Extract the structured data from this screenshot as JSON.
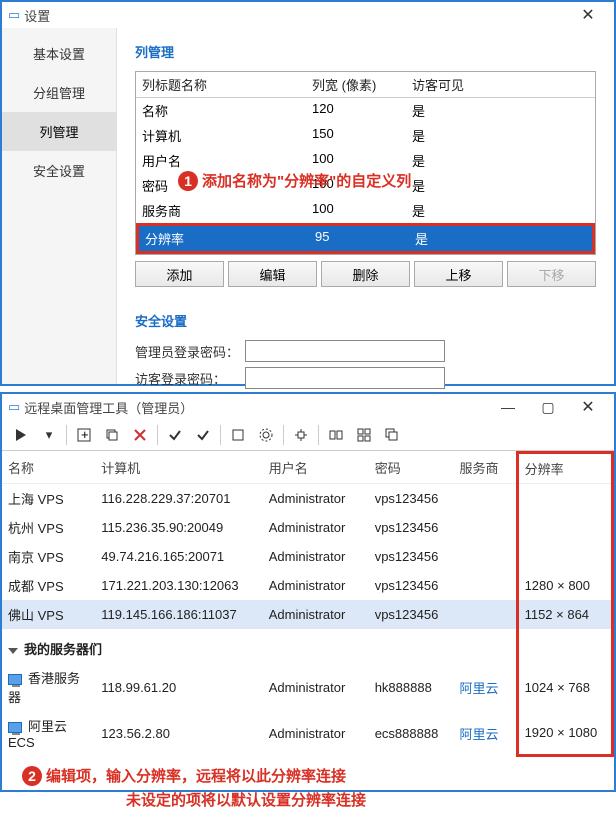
{
  "settings": {
    "title": "设置",
    "tabs": [
      "基本设置",
      "分组管理",
      "列管理",
      "安全设置"
    ],
    "active_tab": 2,
    "panel_title": "列管理",
    "columns_header": {
      "name": "列标题名称",
      "width": "列宽 (像素)",
      "visible": "访客可见"
    },
    "columns": [
      {
        "name": "名称",
        "width": "120",
        "visible": "是"
      },
      {
        "name": "计算机",
        "width": "150",
        "visible": "是"
      },
      {
        "name": "用户名",
        "width": "100",
        "visible": "是"
      },
      {
        "name": "密码",
        "width": "100",
        "visible": "是"
      },
      {
        "name": "服务商",
        "width": "100",
        "visible": "是"
      },
      {
        "name": "分辨率",
        "width": "95",
        "visible": "是"
      }
    ],
    "selected_column": 5,
    "buttons": {
      "add": "添加",
      "edit": "编辑",
      "delete": "删除",
      "up": "上移",
      "down": "下移"
    },
    "security_title": "安全设置",
    "admin_pw_label": "管理员登录密码：",
    "guest_pw_label": "访客登录密码：",
    "annot": "添加名称为\"分辨率\"的自定义列"
  },
  "main": {
    "title": "远程桌面管理工具（管理员）",
    "headers": [
      "名称",
      "计算机",
      "用户名",
      "密码",
      "服务商",
      "分辨率"
    ],
    "rows": [
      {
        "name": "上海 VPS",
        "host": "116.228.229.37:20701",
        "user": "Administrator",
        "pass": "vps123456",
        "prov": "",
        "res": ""
      },
      {
        "name": "杭州 VPS",
        "host": "115.236.35.90:20049",
        "user": "Administrator",
        "pass": "vps123456",
        "prov": "",
        "res": ""
      },
      {
        "name": "南京 VPS",
        "host": "49.74.216.165:20071",
        "user": "Administrator",
        "pass": "vps123456",
        "prov": "",
        "res": ""
      },
      {
        "name": "成都 VPS",
        "host": "171.221.203.130:12063",
        "user": "Administrator",
        "pass": "vps123456",
        "prov": "",
        "res": "1280 × 800"
      },
      {
        "name": "佛山 VPS",
        "host": "119.145.166.186:11037",
        "user": "Administrator",
        "pass": "vps123456",
        "prov": "",
        "res": "1152 × 864"
      }
    ],
    "selected_row": 4,
    "group_name": "我的服务器们",
    "group_rows": [
      {
        "name": "香港服务器",
        "host": "118.99.61.20",
        "user": "Administrator",
        "pass": "hk888888",
        "prov": "阿里云",
        "res": "1024 × 768"
      },
      {
        "name": "阿里云 ECS",
        "host": "123.56.2.80",
        "user": "Administrator",
        "pass": "ecs888888",
        "prov": "阿里云",
        "res": "1920 × 1080"
      }
    ],
    "annot_line1": "编辑项，输入分辨率，远程将以此分辨率连接",
    "annot_line2": "未设定的项将以默认设置分辨率连接"
  }
}
